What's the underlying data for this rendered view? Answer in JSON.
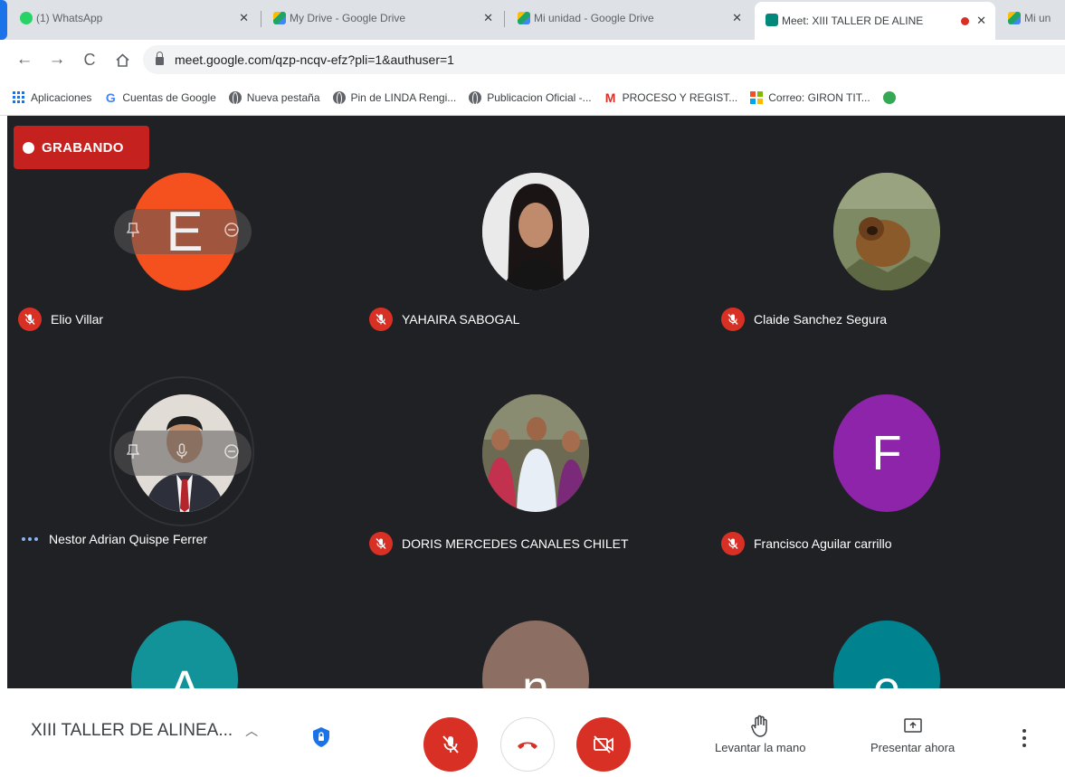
{
  "browser": {
    "tabs": [
      {
        "title": "(1) WhatsApp",
        "favicon_color": "#25d366"
      },
      {
        "title": "My Drive - Google Drive",
        "favicon_color": "#1fa463"
      },
      {
        "title": "Mi unidad - Google Drive",
        "favicon_color": "#1fa463"
      },
      {
        "title": "Meet: XIII TALLER DE ALINE",
        "favicon_color": "#00897b"
      },
      {
        "title": "Mi un",
        "favicon_color": "#1fa463"
      }
    ],
    "url": "meet.google.com/qzp-ncqv-efz?pli=1&authuser=1",
    "bookmarks": [
      {
        "label": "Aplicaciones",
        "icon": "apps-icon"
      },
      {
        "label": "Cuentas de Google",
        "icon": "google-g-icon"
      },
      {
        "label": "Nueva pestaña",
        "icon": "globe-icon"
      },
      {
        "label": "Pin de LINDA Rengi...",
        "icon": "globe-icon"
      },
      {
        "label": "Publicacion Oficial -...",
        "icon": "globe-icon"
      },
      {
        "label": "PROCESO Y REGIST...",
        "icon": "gmail-icon"
      },
      {
        "label": "Correo: GIRON TIT...",
        "icon": "outlook-icon"
      }
    ]
  },
  "meeting": {
    "recording_label": "GRABANDO",
    "participants": [
      {
        "name": "Elio Villar",
        "initial": "E",
        "avatar_color": "#f4511e",
        "muted": true
      },
      {
        "name": "YAHAIRA SABOGAL",
        "initial": "",
        "avatar_color": "#e8e8e8",
        "muted": true
      },
      {
        "name": "Claide Sanchez Segura",
        "initial": "",
        "avatar_color": "#6d7a4e",
        "muted": true
      },
      {
        "name": "Nestor Adrian Quispe Ferrer",
        "initial": "",
        "avatar_color": "#c9a07d",
        "muted": false
      },
      {
        "name": "DORIS MERCEDES CANALES CHILET",
        "initial": "",
        "avatar_color": "#7c6f62",
        "muted": true
      },
      {
        "name": "Francisco Aguilar carrillo",
        "initial": "F",
        "avatar_color": "#8e24aa",
        "muted": true
      },
      {
        "name": "",
        "initial": "A",
        "avatar_color": "#12939a",
        "muted": false
      },
      {
        "name": "",
        "initial": "n",
        "avatar_color": "#8d6e63",
        "muted": false
      },
      {
        "name": "",
        "initial": "e",
        "avatar_color": "#00838f",
        "muted": false
      }
    ]
  },
  "controls": {
    "meeting_title": "XIII TALLER DE ALINEA...",
    "raise_hand_label": "Levantar la mano",
    "present_label": "Presentar ahora",
    "accent_red": "#d93025"
  }
}
